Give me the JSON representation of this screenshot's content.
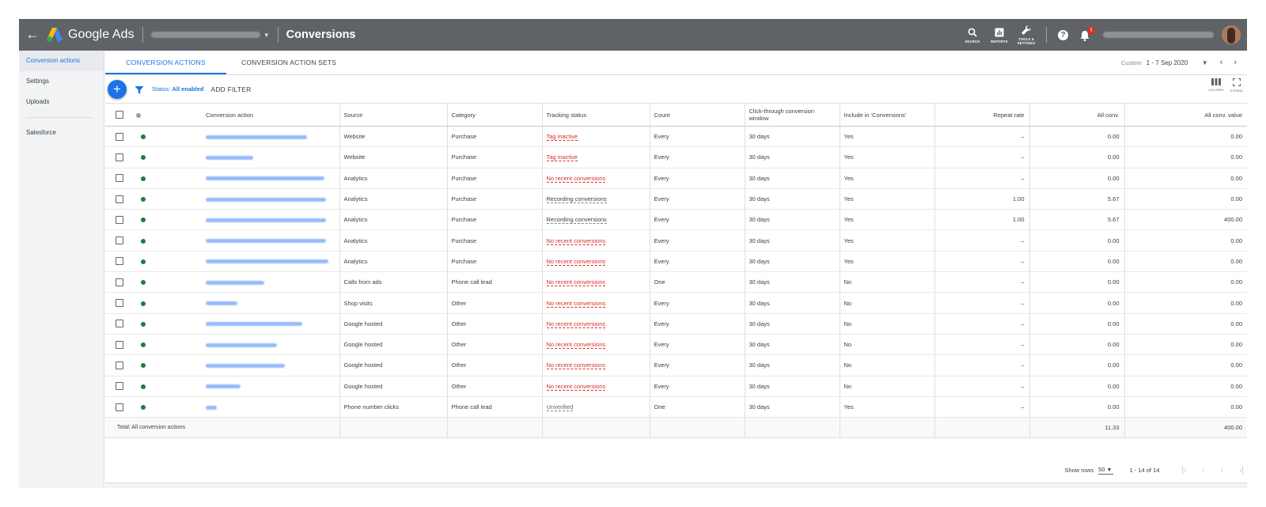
{
  "header": {
    "brand": "Google Ads",
    "page_title": "Conversions",
    "icons": [
      {
        "name": "search-icon",
        "label": "SEARCH"
      },
      {
        "name": "reports-icon",
        "label": "REPORTS"
      },
      {
        "name": "tools-icon",
        "label": "TOOLS & SETTINGS"
      }
    ],
    "help_glyph": "?",
    "notification_count": "!"
  },
  "sidebar": {
    "items": [
      {
        "label": "Conversion actions",
        "active": true
      },
      {
        "label": "Settings"
      },
      {
        "label": "Uploads"
      },
      {
        "label": "Salesforce"
      }
    ]
  },
  "tabs": [
    "CONVERSION ACTIONS",
    "CONVERSION ACTION SETS"
  ],
  "date": {
    "label": "Custom",
    "range": "1 - 7 Sep 2020"
  },
  "filter": {
    "status_prefix": "Status:",
    "status_value": "All enabled",
    "add_filter": "ADD FILTER"
  },
  "toolbar_right": [
    "COLUMNS",
    "EXPAND"
  ],
  "columns": [
    "Conversion action",
    "Source",
    "Category",
    "Tracking status",
    "Count",
    "Click-through conversion window",
    "Include in 'Conversions'",
    "Repeat rate",
    "All conv.",
    "All conv. value"
  ],
  "rows": [
    {
      "source": "Website",
      "category": "Purchase",
      "tracking": "Tag inactive",
      "tracking_type": "bad",
      "count": "Every",
      "window": "30 days",
      "include": "Yes",
      "repeat": "–",
      "all_conv": "0.00",
      "all_value": "0.00"
    },
    {
      "source": "Website",
      "category": "Purchase",
      "tracking": "Tag inactive",
      "tracking_type": "bad",
      "count": "Every",
      "window": "30 days",
      "include": "Yes",
      "repeat": "–",
      "all_conv": "0.00",
      "all_value": "0.00"
    },
    {
      "source": "Analytics",
      "category": "Purchase",
      "tracking": "No recent conversions",
      "tracking_type": "bad",
      "count": "Every",
      "window": "30 days",
      "include": "Yes",
      "repeat": "–",
      "all_conv": "0.00",
      "all_value": "0.00"
    },
    {
      "source": "Analytics",
      "category": "Purchase",
      "tracking": "Recording conversions",
      "tracking_type": "ok",
      "count": "Every",
      "window": "30 days",
      "include": "Yes",
      "repeat": "1.00",
      "all_conv": "5.67",
      "all_value": "0.00"
    },
    {
      "source": "Analytics",
      "category": "Purchase",
      "tracking": "Recording conversions",
      "tracking_type": "ok",
      "count": "Every",
      "window": "30 days",
      "include": "Yes",
      "repeat": "1.00",
      "all_conv": "5.67",
      "all_value": "400.00"
    },
    {
      "source": "Analytics",
      "category": "Purchase",
      "tracking": "No recent conversions",
      "tracking_type": "bad",
      "count": "Every",
      "window": "30 days",
      "include": "Yes",
      "repeat": "–",
      "all_conv": "0.00",
      "all_value": "0.00"
    },
    {
      "source": "Analytics",
      "category": "Purchase",
      "tracking": "No recent conversions",
      "tracking_type": "bad",
      "count": "Every",
      "window": "30 days",
      "include": "Yes",
      "repeat": "–",
      "all_conv": "0.00",
      "all_value": "0.00"
    },
    {
      "source": "Calls from ads",
      "category": "Phone call lead",
      "tracking": "No recent conversions",
      "tracking_type": "bad",
      "count": "One",
      "window": "30 days",
      "include": "No",
      "repeat": "–",
      "all_conv": "0.00",
      "all_value": "0.00"
    },
    {
      "source": "Shop visits",
      "category": "Other",
      "tracking": "No recent conversions",
      "tracking_type": "bad",
      "count": "Every",
      "window": "30 days",
      "include": "No",
      "repeat": "–",
      "all_conv": "0.00",
      "all_value": "0.00"
    },
    {
      "source": "Google hosted",
      "category": "Other",
      "tracking": "No recent conversions",
      "tracking_type": "bad",
      "count": "Every",
      "window": "30 days",
      "include": "No",
      "repeat": "–",
      "all_conv": "0.00",
      "all_value": "0.00"
    },
    {
      "source": "Google hosted",
      "category": "Other",
      "tracking": "No recent conversions",
      "tracking_type": "bad",
      "count": "Every",
      "window": "30 days",
      "include": "No",
      "repeat": "–",
      "all_conv": "0.00",
      "all_value": "0.00"
    },
    {
      "source": "Google hosted",
      "category": "Other",
      "tracking": "No recent conversions",
      "tracking_type": "bad",
      "count": "Every",
      "window": "30 days",
      "include": "No",
      "repeat": "–",
      "all_conv": "0.00",
      "all_value": "0.00"
    },
    {
      "source": "Google hosted",
      "category": "Other",
      "tracking": "No recent conversions",
      "tracking_type": "bad",
      "count": "Every",
      "window": "30 days",
      "include": "No",
      "repeat": "–",
      "all_conv": "0.00",
      "all_value": "0.00"
    },
    {
      "source": "Phone number clicks",
      "category": "Phone call lead",
      "tracking": "Unverified",
      "tracking_type": "unverified",
      "count": "One",
      "window": "30 days",
      "include": "Yes",
      "repeat": "–",
      "all_conv": "0.00",
      "all_value": "0.00"
    }
  ],
  "total": {
    "label": "Total: All conversion actions",
    "all_conv": "11.33",
    "all_value": "400.00"
  },
  "pagination": {
    "show_rows_label": "Show rows",
    "rows_value": "50",
    "range": "1 - 14 of 14"
  },
  "colors": {
    "header_bg": "#5f6368",
    "accent": "#1a73e8",
    "error": "#d93025",
    "enabled_dot": "#188038"
  }
}
